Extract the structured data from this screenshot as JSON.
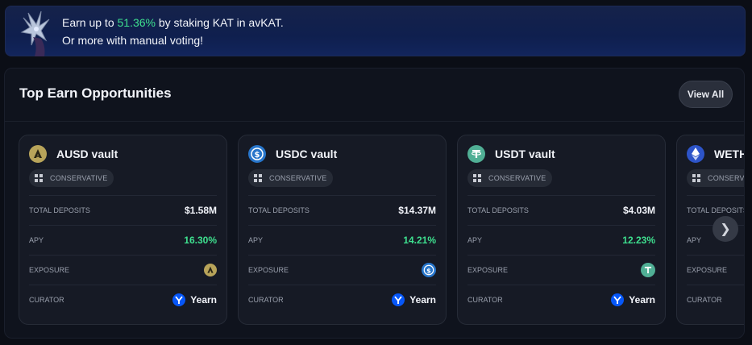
{
  "banner": {
    "line1_prefix": "Earn up to ",
    "line1_highlight": "51.36%",
    "line1_suffix": " by staking KAT in avKAT.",
    "line2": "Or more with manual voting!"
  },
  "section": {
    "title": "Top Earn Opportunities",
    "view_all_label": "View All"
  },
  "colors": {
    "accent_green": "#3ee08f",
    "usdc_blue": "#2775ca",
    "usdt_green": "#50af95",
    "ausd_gold": "#b8a45a",
    "eth_blue": "#2d54c8",
    "yearn_blue": "#0657f9"
  },
  "cards": [
    {
      "title": "AUSD vault",
      "token_icon": "ausd-icon",
      "risk": "CONSERVATIVE",
      "total_deposits_label": "TOTAL DEPOSITS",
      "total_deposits": "$1.58M",
      "apy_label": "APY",
      "apy": "16.30%",
      "exposure_label": "EXPOSURE",
      "curator_label": "CURATOR",
      "curator": "Yearn"
    },
    {
      "title": "USDC vault",
      "token_icon": "usdc-icon",
      "risk": "CONSERVATIVE",
      "total_deposits_label": "TOTAL DEPOSITS",
      "total_deposits": "$14.37M",
      "apy_label": "APY",
      "apy": "14.21%",
      "exposure_label": "EXPOSURE",
      "curator_label": "CURATOR",
      "curator": "Yearn"
    },
    {
      "title": "USDT vault",
      "token_icon": "usdt-icon",
      "risk": "CONSERVATIVE",
      "total_deposits_label": "TOTAL DEPOSITS",
      "total_deposits": "$4.03M",
      "apy_label": "APY",
      "apy": "12.23%",
      "exposure_label": "EXPOSURE",
      "curator_label": "CURATOR",
      "curator": "Yearn"
    },
    {
      "title": "WETH",
      "token_icon": "eth-icon",
      "risk": "CONSERVATIVE",
      "total_deposits_label": "TOTAL DEPOSITS",
      "apy_label": "APY",
      "exposure_label": "EXPOSURE",
      "curator_label": "CURATOR"
    }
  ],
  "carousel": {
    "next_icon": "chevron-right-icon"
  }
}
